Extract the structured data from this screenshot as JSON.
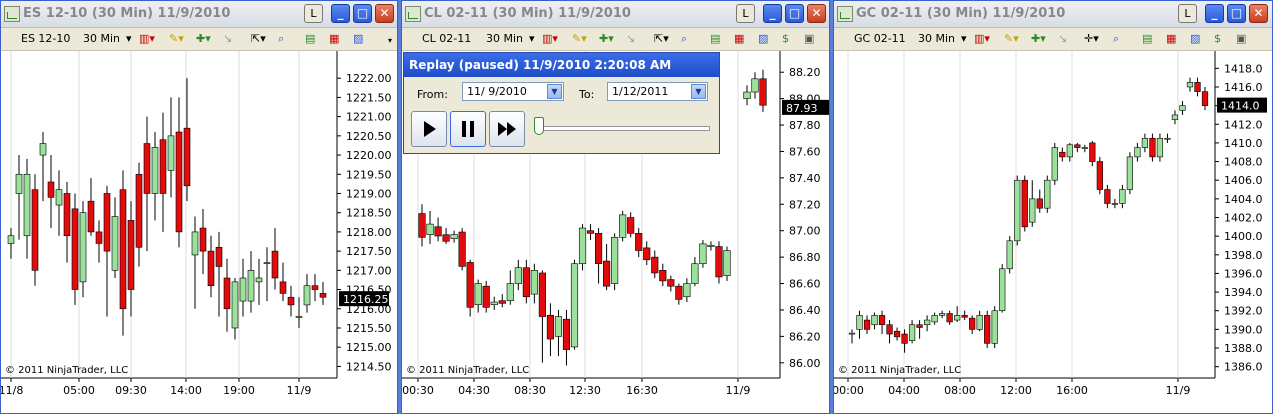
{
  "colors": {
    "up": "#9be09b",
    "down": "#e10b0b",
    "price_tag": "#000000",
    "desktop": "#5a7edc"
  },
  "windows": [
    {
      "title": "ES 12-10 (30 Min)  11/9/2010",
      "l_button": "L",
      "toolbar": {
        "instrument": "ES 12-10",
        "period": "30 Min"
      },
      "copyright": "© 2011 NinjaTrader, LLC",
      "last_price": "1216.25",
      "chart_data": {
        "type": "candlestick",
        "y_ticks": [
          "1222.00",
          "1221.50",
          "1221.00",
          "1220.50",
          "1220.00",
          "1219.50",
          "1219.00",
          "1218.50",
          "1218.00",
          "1217.50",
          "1217.00",
          "1216.50",
          "1216.00",
          "1215.50",
          "1215.00",
          "1214.50"
        ],
        "ylim": [
          1214.25,
          1222.5
        ],
        "x_ticks": [
          "11/8",
          "05:00",
          "09:30",
          "14:00",
          "19:00",
          "11/9"
        ],
        "candles": [
          [
            1217.7,
            1217.9,
            1218.1,
            1217.3
          ],
          [
            1219.0,
            1219.5,
            1220.0,
            1217.8
          ],
          [
            1217.9,
            1219.5,
            1219.9,
            1217.3
          ],
          [
            1219.1,
            1217.0,
            1219.5,
            1216.6
          ],
          [
            1220.0,
            1220.3,
            1220.6,
            1218.8
          ],
          [
            1219.3,
            1218.9,
            1220.0,
            1218.1
          ],
          [
            1218.7,
            1219.1,
            1219.6,
            1217.9
          ],
          [
            1219.0,
            1217.9,
            1219.3,
            1217.2
          ],
          [
            1218.6,
            1216.5,
            1219.0,
            1216.1
          ],
          [
            1216.7,
            1218.5,
            1218.8,
            1216.3
          ],
          [
            1218.8,
            1218.0,
            1219.4,
            1217.9
          ],
          [
            1218.0,
            1217.7,
            1218.3,
            1217.2
          ],
          [
            1219.0,
            1217.5,
            1219.2,
            1215.8
          ],
          [
            1217.0,
            1218.4,
            1218.9,
            1216.8
          ],
          [
            1219.1,
            1216.0,
            1219.6,
            1215.3
          ],
          [
            1218.3,
            1216.5,
            1218.8,
            1215.8
          ],
          [
            1219.5,
            1217.6,
            1219.8,
            1217.1
          ],
          [
            1220.3,
            1219.0,
            1221.0,
            1217.5
          ],
          [
            1219.0,
            1220.2,
            1220.6,
            1218.3
          ],
          [
            1220.4,
            1219.0,
            1221.1,
            1218.0
          ],
          [
            1219.6,
            1220.5,
            1221.5,
            1218.9
          ],
          [
            1220.6,
            1218.0,
            1221.5,
            1217.6
          ],
          [
            1220.7,
            1219.2,
            1222.0,
            1218.8
          ],
          [
            1217.4,
            1218.0,
            1218.4,
            1216.0
          ],
          [
            1218.1,
            1217.5,
            1218.6,
            1216.9
          ],
          [
            1217.5,
            1216.6,
            1217.9,
            1216.3
          ],
          [
            1217.6,
            1217.1,
            1218.0,
            1215.8
          ],
          [
            1216.8,
            1216.0,
            1217.3,
            1215.4
          ],
          [
            1215.5,
            1216.7,
            1216.8,
            1215.2
          ],
          [
            1216.2,
            1216.8,
            1217.3,
            1215.8
          ],
          [
            1216.2,
            1217.0,
            1217.5,
            1215.9
          ],
          [
            1216.7,
            1216.8,
            1217.3,
            1216.1
          ],
          [
            1217.2,
            1217.2,
            1217.6,
            1216.2
          ],
          [
            1217.5,
            1216.8,
            1218.1,
            1216.5
          ],
          [
            1216.7,
            1216.4,
            1217.2,
            1216.2
          ],
          [
            1216.3,
            1216.1,
            1216.6,
            1215.8
          ],
          [
            1215.8,
            1215.8,
            1216.3,
            1215.5
          ],
          [
            1216.1,
            1216.6,
            1216.9,
            1215.9
          ],
          [
            1216.6,
            1216.5,
            1216.9,
            1216.2
          ],
          [
            1216.4,
            1216.3,
            1216.7,
            1216.1
          ]
        ]
      }
    },
    {
      "title": "CL 02-11 (30 Min)  11/9/2010",
      "l_button": "L",
      "toolbar": {
        "instrument": "CL 02-11",
        "period": "30 Min"
      },
      "copyright": "© 2011 NinjaTrader, LLC",
      "last_price": "87.93",
      "chart_data": {
        "type": "candlestick",
        "y_ticks": [
          "88.20",
          "88.00",
          "87.80",
          "87.60",
          "87.40",
          "87.20",
          "87.00",
          "86.80",
          "86.60",
          "86.40",
          "86.20",
          "86.00"
        ],
        "ylim": [
          85.9,
          88.3
        ],
        "x_ticks": [
          "00:30",
          "04:30",
          "08:30",
          "12:30",
          "16:30",
          "11/9"
        ],
        "candles": [
          [
            87.13,
            86.95,
            87.2,
            86.88
          ],
          [
            86.97,
            87.05,
            87.15,
            86.9
          ],
          [
            87.03,
            86.96,
            87.1,
            86.92
          ],
          [
            86.97,
            86.92,
            87.02,
            86.9
          ],
          [
            86.94,
            86.97,
            87.0,
            86.91
          ],
          [
            86.99,
            86.73,
            87.02,
            86.7
          ],
          [
            86.76,
            86.42,
            86.78,
            86.35
          ],
          [
            86.44,
            86.6,
            86.63,
            86.38
          ],
          [
            86.58,
            86.42,
            86.62,
            86.38
          ],
          [
            86.44,
            86.46,
            86.5,
            86.4
          ],
          [
            86.47,
            86.45,
            86.52,
            86.42
          ],
          [
            86.47,
            86.6,
            86.7,
            86.44
          ],
          [
            86.6,
            86.72,
            86.78,
            86.55
          ],
          [
            86.72,
            86.5,
            86.78,
            86.45
          ],
          [
            86.52,
            86.7,
            86.75,
            86.45
          ],
          [
            86.68,
            86.35,
            86.7,
            86.0
          ],
          [
            86.36,
            86.18,
            86.45,
            86.05
          ],
          [
            86.2,
            86.35,
            86.4,
            86.05
          ],
          [
            86.33,
            86.1,
            86.4,
            85.98
          ],
          [
            86.12,
            86.75,
            86.78,
            86.1
          ],
          [
            86.75,
            87.02,
            87.05,
            86.7
          ],
          [
            87.0,
            86.98,
            87.05,
            86.93
          ],
          [
            86.98,
            86.75,
            87.02,
            86.6
          ],
          [
            86.77,
            86.58,
            86.9,
            86.55
          ],
          [
            86.6,
            86.95,
            86.98,
            86.55
          ],
          [
            86.95,
            87.12,
            87.15,
            86.92
          ],
          [
            87.1,
            86.98,
            87.14,
            86.95
          ],
          [
            86.98,
            86.85,
            87.02,
            86.8
          ],
          [
            86.87,
            86.78,
            86.92,
            86.74
          ],
          [
            86.8,
            86.68,
            86.85,
            86.64
          ],
          [
            86.7,
            86.62,
            86.75,
            86.58
          ],
          [
            86.63,
            86.58,
            86.66,
            86.54
          ],
          [
            86.58,
            86.48,
            86.6,
            86.44
          ],
          [
            86.5,
            86.6,
            86.64,
            86.46
          ],
          [
            86.6,
            86.75,
            86.8,
            86.58
          ],
          [
            86.75,
            86.9,
            86.93,
            86.72
          ],
          [
            86.88,
            86.89,
            86.92,
            86.85
          ],
          [
            86.88,
            86.65,
            86.92,
            86.6
          ],
          [
            86.66,
            86.85,
            86.88,
            86.62
          ],
          [
            88.0,
            88.05,
            88.1,
            87.95
          ],
          [
            88.05,
            88.15,
            88.2,
            88.0
          ],
          [
            88.15,
            87.95,
            88.22,
            87.9
          ]
        ]
      }
    },
    {
      "title": "GC 02-11 (30 Min)  11/9/2010",
      "l_button": "L",
      "toolbar": {
        "instrument": "GC 02-11",
        "period": "30 Min"
      },
      "copyright": "© 2011 NinjaTrader, LLC",
      "last_price": "1414.0",
      "chart_data": {
        "type": "candlestick",
        "y_ticks": [
          "1418.0",
          "1416.0",
          "1414.0",
          "1412.0",
          "1410.0",
          "1408.0",
          "1406.0",
          "1404.0",
          "1402.0",
          "1400.0",
          "1398.0",
          "1396.0",
          "1394.0",
          "1392.0",
          "1390.0",
          "1388.0",
          "1386.0"
        ],
        "ylim": [
          1385,
          1419
        ],
        "x_ticks": [
          "00:00",
          "04:00",
          "08:00",
          "12:00",
          "16:00",
          "11/9"
        ],
        "candles": [
          [
            1389.5,
            1389.6,
            1390.0,
            1388.5
          ],
          [
            1390.0,
            1391.5,
            1392.0,
            1389.0
          ],
          [
            1391.0,
            1390.0,
            1391.5,
            1389.5
          ],
          [
            1390.5,
            1391.5,
            1391.8,
            1390.0
          ],
          [
            1391.5,
            1390.5,
            1392.0,
            1389.5
          ],
          [
            1390.5,
            1389.5,
            1391.0,
            1388.5
          ],
          [
            1389.8,
            1389.2,
            1390.2,
            1388.8
          ],
          [
            1389.5,
            1388.5,
            1390.0,
            1387.5
          ],
          [
            1388.8,
            1390.5,
            1391.0,
            1388.5
          ],
          [
            1390.5,
            1390.2,
            1391.0,
            1389.0
          ],
          [
            1390.5,
            1391.0,
            1391.5,
            1389.8
          ],
          [
            1390.8,
            1391.5,
            1391.8,
            1390.5
          ],
          [
            1391.5,
            1391.7,
            1392.0,
            1391.2
          ],
          [
            1391.7,
            1390.8,
            1392.0,
            1390.5
          ],
          [
            1391.0,
            1391.5,
            1392.5,
            1390.8
          ],
          [
            1391.5,
            1391.3,
            1392.0,
            1391.0
          ],
          [
            1391.2,
            1390.0,
            1391.5,
            1389.5
          ],
          [
            1390.0,
            1391.5,
            1392.0,
            1389.8
          ],
          [
            1391.5,
            1388.5,
            1392.0,
            1388.0
          ],
          [
            1388.5,
            1392.0,
            1392.5,
            1388.0
          ],
          [
            1392.0,
            1396.5,
            1397.0,
            1391.8
          ],
          [
            1396.5,
            1399.5,
            1400.0,
            1396.0
          ],
          [
            1399.5,
            1406.0,
            1406.5,
            1399.0
          ],
          [
            1406.0,
            1401.0,
            1406.5,
            1400.5
          ],
          [
            1401.5,
            1404.0,
            1406.0,
            1401.0
          ],
          [
            1404.0,
            1403.0,
            1405.0,
            1402.5
          ],
          [
            1403.0,
            1406.0,
            1406.5,
            1402.5
          ],
          [
            1406.0,
            1409.5,
            1410.0,
            1405.5
          ],
          [
            1409.0,
            1408.5,
            1409.5,
            1408.0
          ],
          [
            1408.5,
            1409.8,
            1410.0,
            1408.0
          ],
          [
            1409.8,
            1409.5,
            1410.0,
            1409.0
          ],
          [
            1409.5,
            1409.5,
            1409.8,
            1409.0
          ],
          [
            1410.0,
            1408.0,
            1410.2,
            1407.5
          ],
          [
            1408.0,
            1405.0,
            1408.5,
            1404.5
          ],
          [
            1405.0,
            1403.5,
            1405.5,
            1403.0
          ],
          [
            1403.5,
            1403.5,
            1404.0,
            1403.0
          ],
          [
            1403.5,
            1405.0,
            1405.5,
            1403.0
          ],
          [
            1405.0,
            1408.5,
            1409.0,
            1404.5
          ],
          [
            1408.5,
            1409.5,
            1410.0,
            1408.0
          ],
          [
            1409.5,
            1410.5,
            1411.0,
            1409.0
          ],
          [
            1410.5,
            1408.5,
            1411.0,
            1408.0
          ],
          [
            1408.5,
            1410.5,
            1411.0,
            1408.0
          ],
          [
            1410.5,
            1410.5,
            1411.0,
            1410.0
          ],
          [
            1412.5,
            1413.0,
            1413.5,
            1412.0
          ],
          [
            1413.5,
            1414.0,
            1414.5,
            1413.0
          ],
          [
            1416.0,
            1416.5,
            1417.0,
            1415.5
          ],
          [
            1416.5,
            1415.5,
            1417.0,
            1415.0
          ],
          [
            1415.5,
            1414.0,
            1416.0,
            1413.5
          ]
        ]
      }
    }
  ],
  "replay": {
    "title": "Replay (paused) 11/9/2010 2:20:08 AM",
    "from_label": "From:",
    "from_value": "11/ 9/2010",
    "to_label": "To:",
    "to_value": "1/12/2011",
    "speed_fraction": 0.0
  }
}
